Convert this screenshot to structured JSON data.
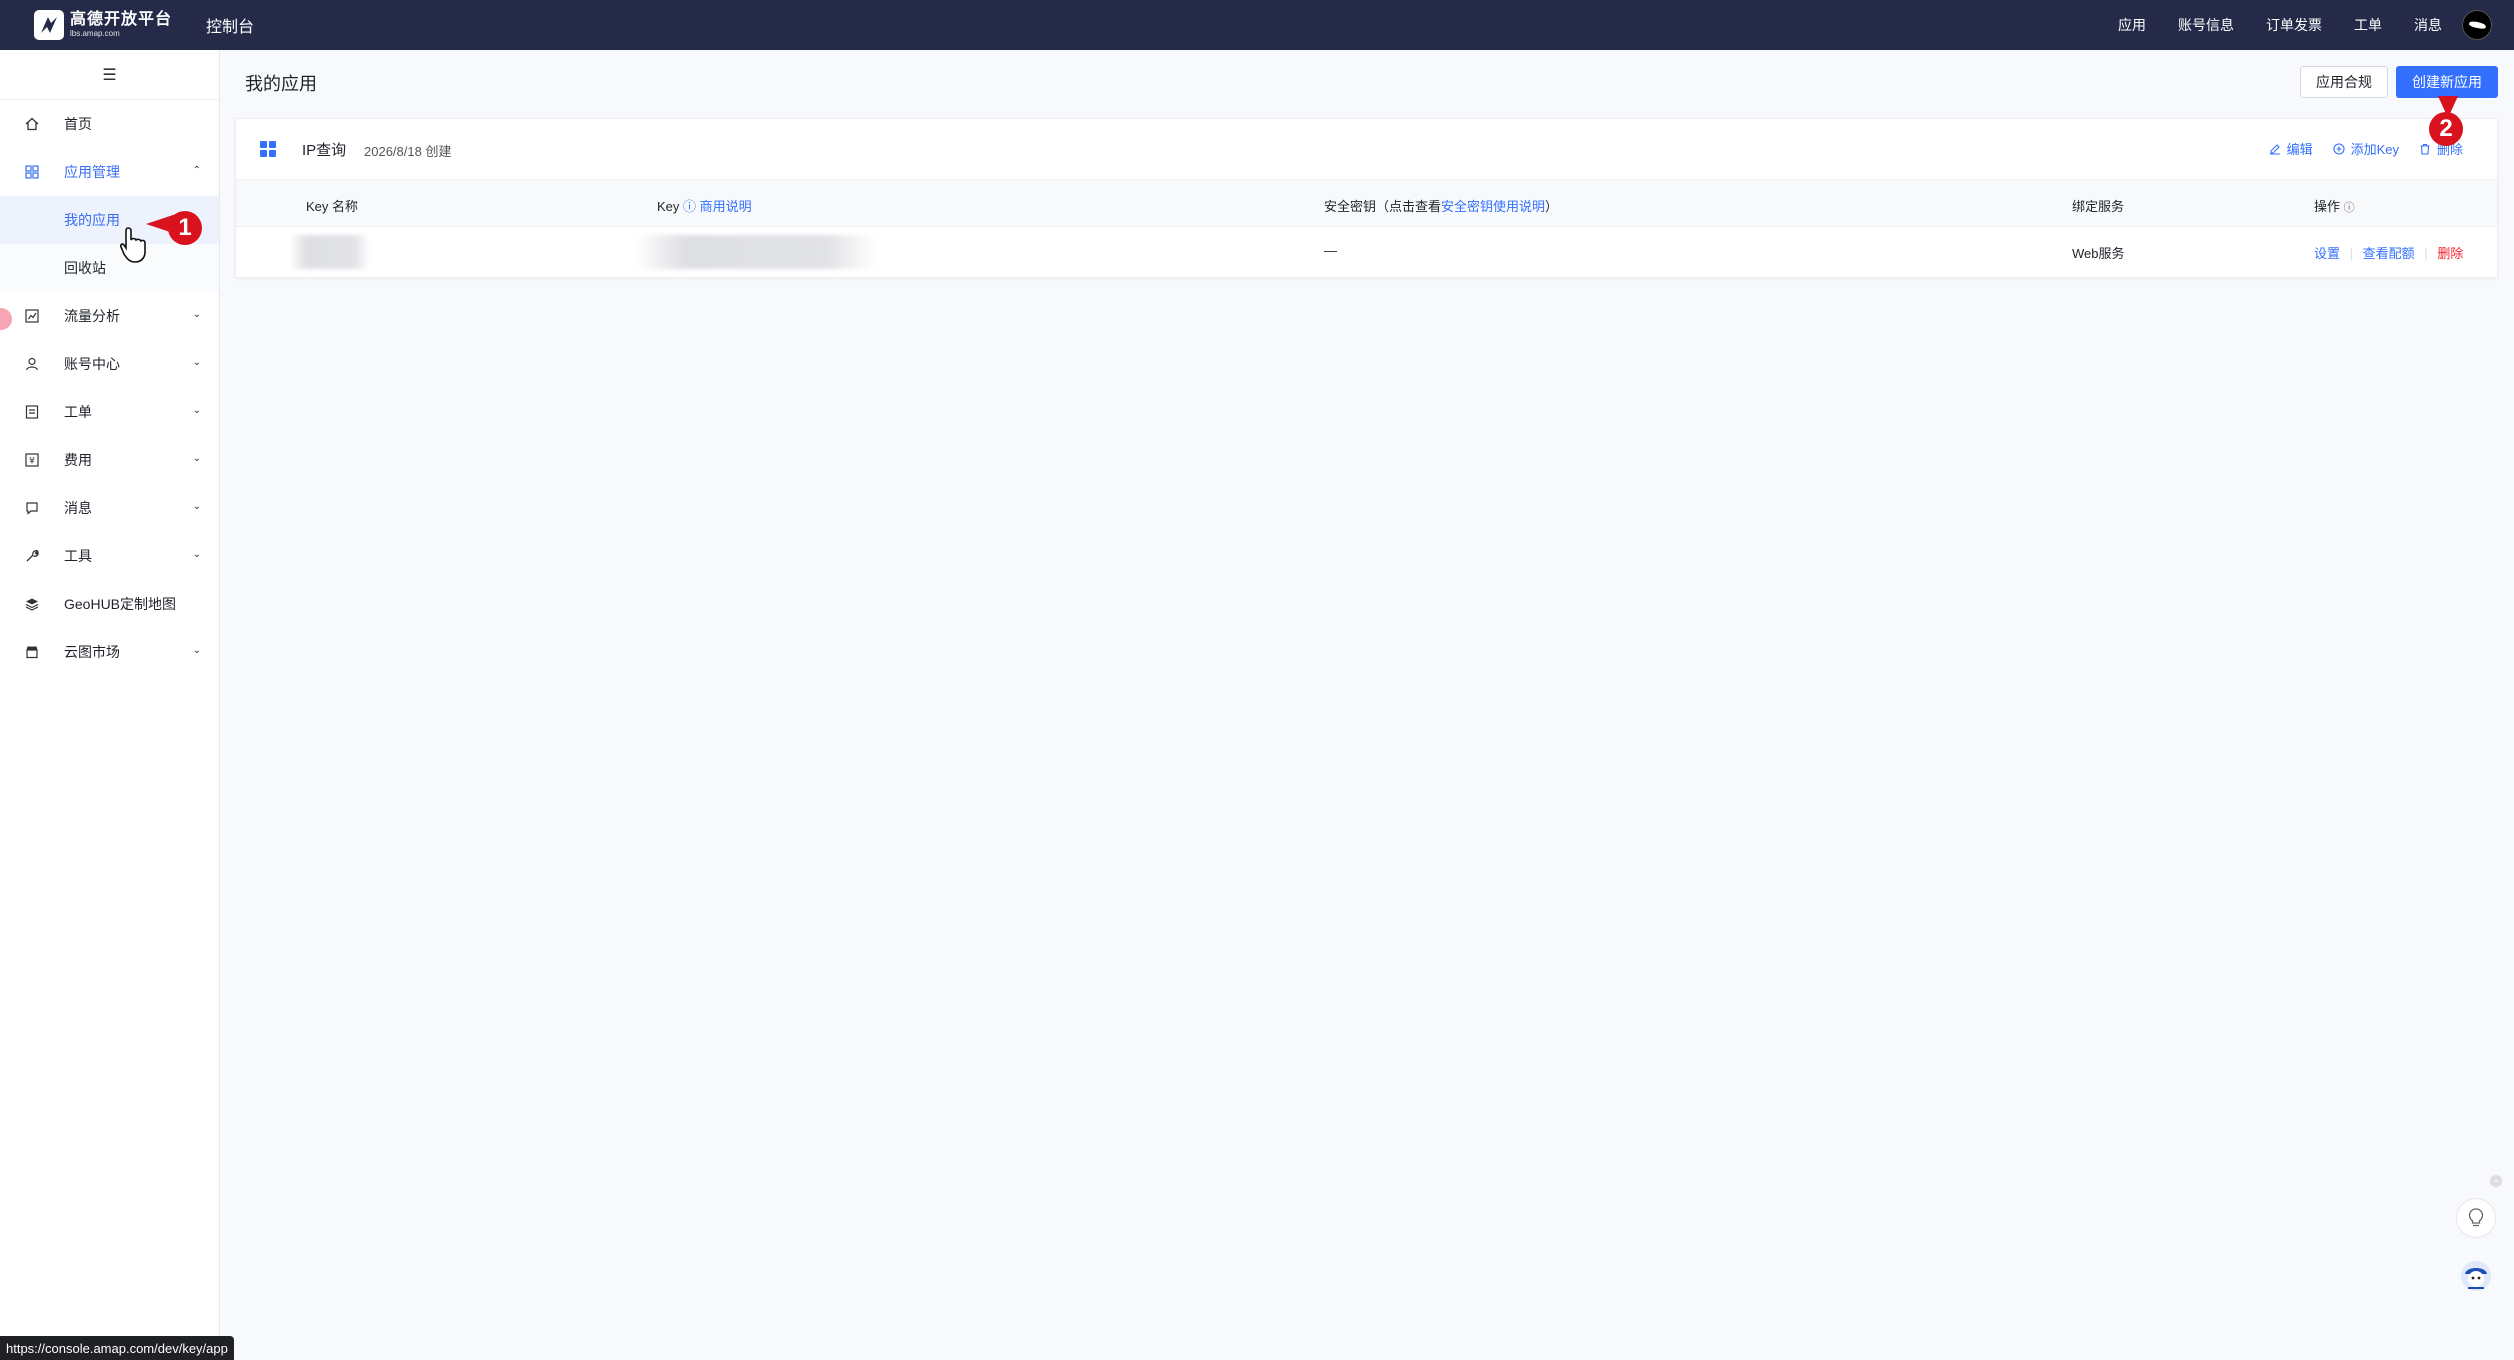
{
  "header": {
    "logo_title": "高德开放平台",
    "logo_subtitle": "lbs.amap.com",
    "console": "控制台",
    "nav": [
      "应用",
      "账号信息",
      "订单发票",
      "工单",
      "消息"
    ]
  },
  "sidebar": {
    "items": [
      {
        "label": "首页",
        "icon": "home-icon"
      },
      {
        "label": "应用管理",
        "icon": "grid-icon"
      },
      {
        "label": "流量分析",
        "icon": "chart-icon"
      },
      {
        "label": "账号中心",
        "icon": "user-icon"
      },
      {
        "label": "工单",
        "icon": "ticket-icon"
      },
      {
        "label": "费用",
        "icon": "fee-icon"
      },
      {
        "label": "消息",
        "icon": "message-icon"
      },
      {
        "label": "工具",
        "icon": "tool-icon"
      },
      {
        "label": "GeoHUB定制地图",
        "icon": "layers-icon"
      },
      {
        "label": "云图市场",
        "icon": "store-icon"
      }
    ],
    "sub_items": [
      "我的应用",
      "回收站"
    ]
  },
  "main": {
    "title": "我的应用",
    "compliance_btn": "应用合规",
    "create_btn": "创建新应用"
  },
  "app": {
    "name": "IP查询",
    "created": "2026/8/18 创建",
    "actions": {
      "edit": "编辑",
      "add_key": "添加Key",
      "delete": "删除"
    },
    "columns": {
      "key_name": "Key 名称",
      "key": "Key",
      "key_usage": "商用说明",
      "secret_prefix": "安全密钥（点击查看",
      "secret_link": "安全密钥使用说明",
      "secret_suffix": "）",
      "service": "绑定服务",
      "ops": "操作"
    },
    "row": {
      "secret": "—",
      "service": "Web服务",
      "op_settings": "设置",
      "op_quota": "查看配额",
      "op_delete": "删除"
    }
  },
  "annotations": {
    "first": "1",
    "second": "2"
  },
  "status_url": "https://console.amap.com/dev/key/app",
  "colors": {
    "topbar": "#242a48",
    "primary": "#3370ff",
    "danger": "#f5222d",
    "badge": "#d8131e"
  }
}
